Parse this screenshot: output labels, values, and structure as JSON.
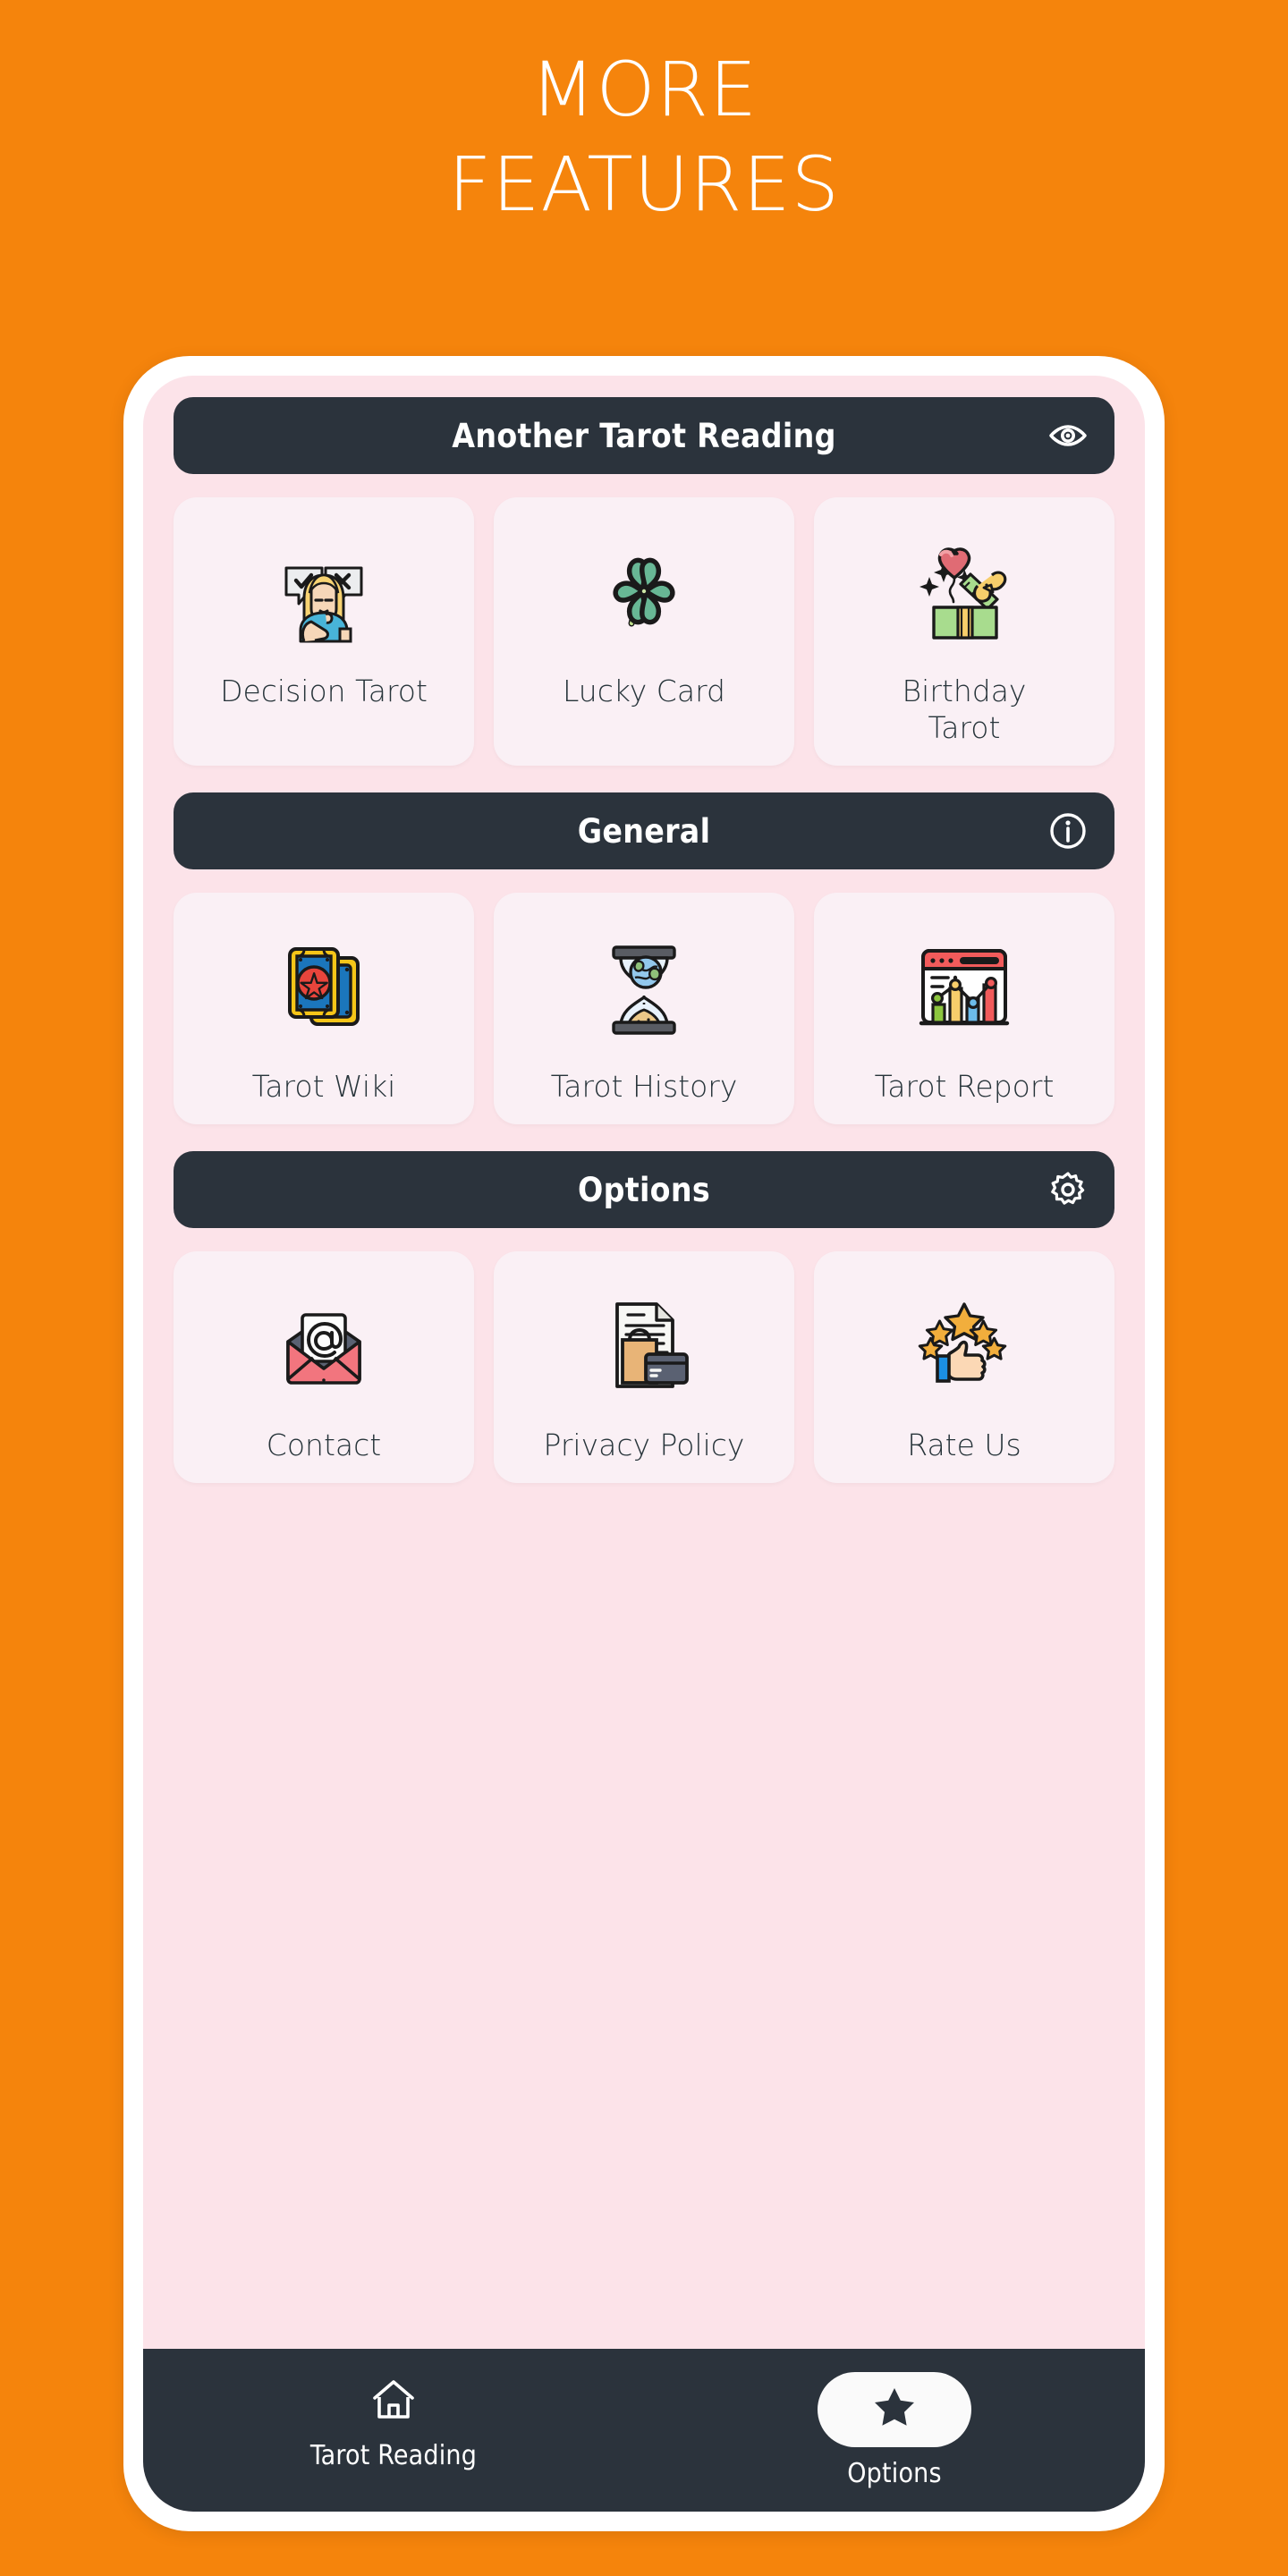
{
  "hero": {
    "line1": "MORE",
    "line2": "FEATURES"
  },
  "colors": {
    "background": "#F5840C",
    "frame": "#FFFFFF",
    "screen": "#FCE3E9",
    "section_bar": "#2B333C",
    "card": "#FAF0F5",
    "label_text": "#27343A",
    "nav_bar": "#2B333C",
    "nav_pill": "#FAFAFA"
  },
  "sections": [
    {
      "title": "Another Tarot Reading",
      "icon": "eye-icon",
      "cards": [
        {
          "label": "Decision Tarot",
          "icon": "decision-person-icon"
        },
        {
          "label": "Lucky Card",
          "icon": "four-leaf-clover-icon"
        },
        {
          "label": "Birthday\nTarot",
          "icon": "gift-heart-icon"
        }
      ]
    },
    {
      "title": "General",
      "icon": "info-circle-icon",
      "cards": [
        {
          "label": "Tarot Wiki",
          "icon": "tarot-cards-icon"
        },
        {
          "label": "Tarot History",
          "icon": "hourglass-globe-icon"
        },
        {
          "label": "Tarot Report",
          "icon": "chart-window-icon"
        }
      ]
    },
    {
      "title": "Options",
      "icon": "gear-icon",
      "cards": [
        {
          "label": "Contact",
          "icon": "envelope-at-icon"
        },
        {
          "label": "Privacy Policy",
          "icon": "document-bag-card-icon"
        },
        {
          "label": "Rate Us",
          "icon": "thumbs-up-stars-icon"
        }
      ]
    }
  ],
  "bottom_nav": {
    "items": [
      {
        "label": "Tarot Reading",
        "icon": "home-icon",
        "active": false
      },
      {
        "label": "Options",
        "icon": "star-icon",
        "active": true
      }
    ]
  }
}
